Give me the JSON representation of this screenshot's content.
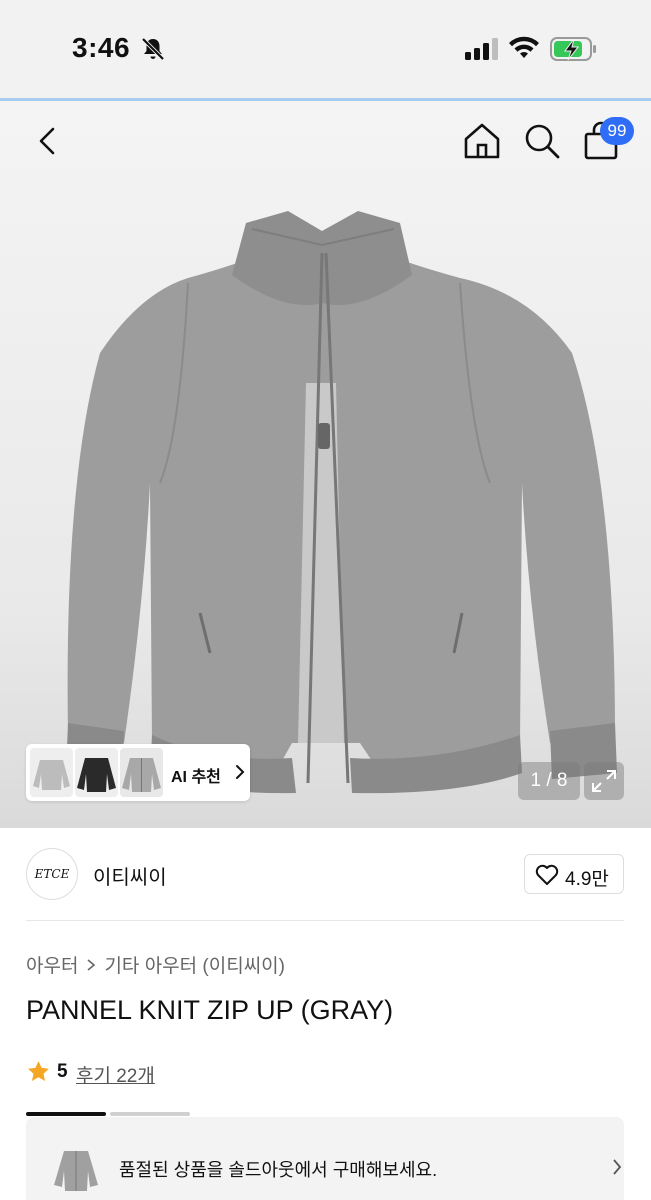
{
  "status_bar": {
    "time": "3:46",
    "icons": [
      "bell-slash-icon",
      "cellular-signal-icon",
      "wifi-icon",
      "battery-charging-icon"
    ]
  },
  "nav": {
    "icons": [
      "back-icon",
      "home-icon",
      "search-icon",
      "cart-icon"
    ],
    "cart_badge": "99"
  },
  "gallery": {
    "page_indicator": "1 / 8",
    "ai_recommend_label": "AI 추천"
  },
  "brand": {
    "logo_text": "ETCE",
    "name": "이티씨이",
    "likes": "4.9만"
  },
  "breadcrumb": {
    "level1": "아우터",
    "level2": "기타 아우터 (이티씨이)"
  },
  "product": {
    "title": "PANNEL KNIT ZIP UP (GRAY)",
    "rating": "5",
    "reviews": "후기 22개"
  },
  "soldout_banner": {
    "message": "품절된 상품을 솔드아웃에서 구매해보세요."
  },
  "colors": {
    "accent": "#2f6df6",
    "star": "#f5a623",
    "jacket": "#9d9d9d"
  }
}
